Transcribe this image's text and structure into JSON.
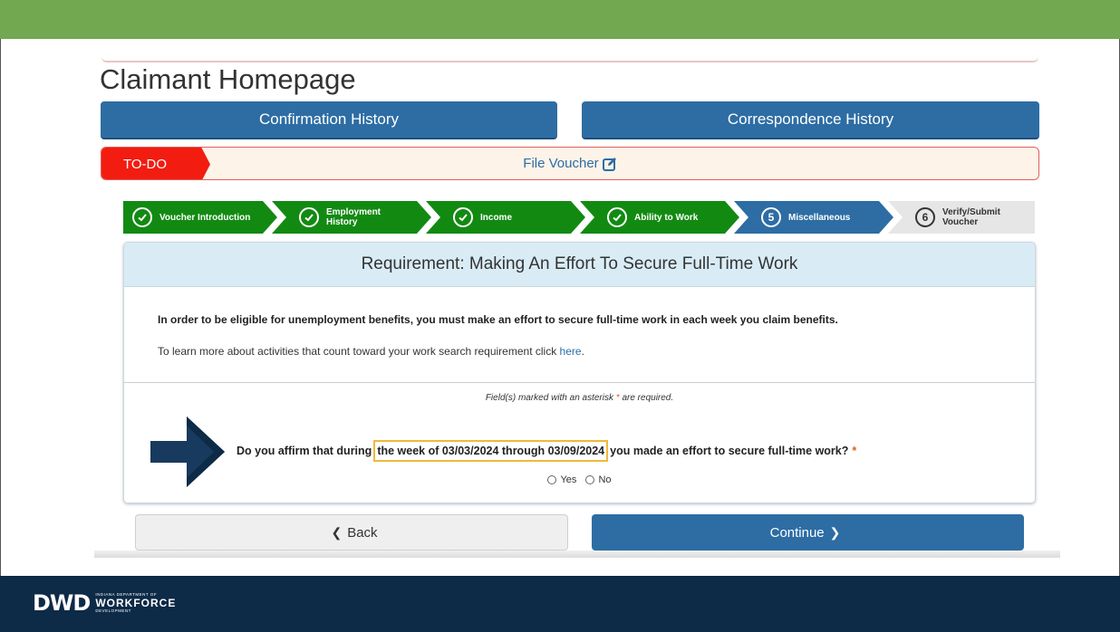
{
  "page": {
    "title": "Claimant Homepage"
  },
  "nav": {
    "confirmation_history": "Confirmation History",
    "correspondence_history": "Correspondence History"
  },
  "todo": {
    "tag": "TO-DO",
    "link": "File Voucher"
  },
  "steps": [
    {
      "number": "",
      "label": "Voucher Introduction",
      "status": "done"
    },
    {
      "number": "",
      "label": "Employment History",
      "status": "done"
    },
    {
      "number": "",
      "label": "Income",
      "status": "done"
    },
    {
      "number": "",
      "label": "Ability to Work",
      "status": "done"
    },
    {
      "number": "5",
      "label": "Miscellaneous",
      "status": "active"
    },
    {
      "number": "6",
      "label": "Verify/Submit Voucher",
      "status": "pending"
    }
  ],
  "card": {
    "header": "Requirement: Making An Effort To Secure Full-Time Work",
    "eligibility": "In order to be eligible for unemployment benefits, you must make an effort to secure full-time work in each week you claim benefits.",
    "learn_more_prefix": "To learn more about activities that count toward your work search requirement click ",
    "learn_more_link": "here",
    "learn_more_suffix": ".",
    "required_note_prefix": "Field(s) marked with an asterisk ",
    "required_note_star": "*",
    "required_note_suffix": " are required.",
    "question_prefix": "Do you affirm that during",
    "question_highlight": "the week of 03/03/2024 through 03/09/2024",
    "question_suffix": "you made an effort to secure full-time work?",
    "question_star": "*",
    "options": [
      "Yes",
      "No"
    ]
  },
  "buttons": {
    "back": "Back",
    "continue": "Continue"
  },
  "footer": {
    "logo_mark": "DWD",
    "logo_small_top": "INDIANA DEPARTMENT OF",
    "logo_big": "WORKFORCE",
    "logo_small_bottom": "DEVELOPMENT"
  },
  "colors": {
    "header_green": "#72a84f",
    "footer_navy": "#0d2a47",
    "primary_blue": "#2d6da4",
    "step_green": "#128a12",
    "todo_red": "#f21c10",
    "highlight_gold": "#f0b93a"
  },
  "icons": {
    "file_voucher": "edit-icon",
    "step_done": "check-circle-icon",
    "pointer": "arrow-right-icon",
    "back": "chevron-left-icon",
    "continue": "chevron-right-icon"
  }
}
